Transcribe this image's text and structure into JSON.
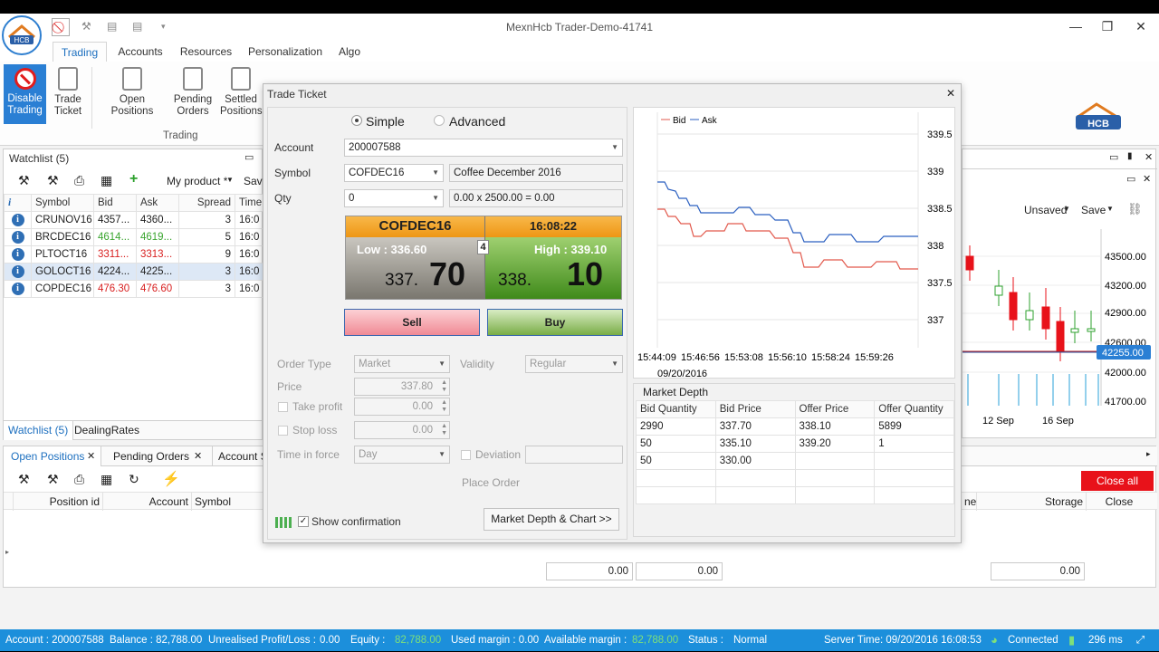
{
  "window": {
    "title": "MexnHcb Trader-Demo-41741"
  },
  "ribbon_tabs": [
    "Trading",
    "Accounts",
    "Resources",
    "Personalization",
    "Algo"
  ],
  "ribbon": {
    "disable_trading": "Disable\nTrading",
    "trade_ticket": "Trade\nTicket",
    "open_positions": "Open Positions",
    "pending_orders": "Pending\nOrders",
    "settled_positions": "Settled\nPositions",
    "group_label": "Trading"
  },
  "logo_text": "HCB",
  "watchlist": {
    "title": "Watchlist (5)",
    "my_product": "My product *",
    "save_short": "Sav",
    "columns": [
      "Symbol",
      "Bid",
      "Ask",
      "Spread",
      "Time"
    ],
    "rows": [
      {
        "symbol": "CRUNOV16",
        "bid": "4357...",
        "ask": "4360...",
        "spread": "3",
        "time": "16:0",
        "bid_color": "",
        "ask_color": ""
      },
      {
        "symbol": "BRCDEC16",
        "bid": "4614...",
        "ask": "4619...",
        "spread": "5",
        "time": "16:0",
        "bid_color": "green",
        "ask_color": "green"
      },
      {
        "symbol": "PLTOCT16",
        "bid": "3311...",
        "ask": "3313...",
        "spread": "9",
        "time": "16:0",
        "bid_color": "red",
        "ask_color": "red"
      },
      {
        "symbol": "GOLOCT16",
        "bid": "4224...",
        "ask": "4225...",
        "spread": "3",
        "time": "16:0",
        "bid_color": "",
        "ask_color": ""
      },
      {
        "symbol": "COPDEC16",
        "bid": "476.30",
        "ask": "476.60",
        "spread": "3",
        "time": "16:0",
        "bid_color": "red",
        "ask_color": "red"
      }
    ],
    "tabs": [
      "Watchlist (5)",
      "DealingRates"
    ]
  },
  "bottom_panel": {
    "tabs": [
      "Open Positions",
      "Pending Orders",
      "Account S"
    ],
    "columns": [
      "Position id",
      "Account",
      "Symbol"
    ],
    "right_columns": [
      "ne",
      "Storage",
      "Close"
    ],
    "close_all": "Close all",
    "totals": [
      "0.00",
      "0.00",
      "0.00"
    ]
  },
  "right_chart": {
    "unsaved": "Unsaved",
    "save": "Save",
    "y_ticks": [
      "43500.00",
      "43200.00",
      "42900.00",
      "42600.00",
      "42000.00",
      "41700.00"
    ],
    "current_price": "42255.00",
    "x_ticks": [
      "12 Sep",
      "16 Sep"
    ]
  },
  "ticket": {
    "title": "Trade Ticket",
    "mode_simple": "Simple",
    "mode_advanced": "Advanced",
    "account_label": "Account",
    "account_value": "200007588",
    "symbol_label": "Symbol",
    "symbol_value": "COFDEC16",
    "symbol_desc": "Coffee December 2016",
    "qty_label": "Qty",
    "qty_value": "0",
    "qty_calc": "0.00 x 2500.00 = 0.00",
    "quote": {
      "symbol": "COFDEC16",
      "time": "16:08:22",
      "low": "Low : 336.60",
      "high": "High : 339.10",
      "spread": "4",
      "bid_small": "337.",
      "bid_big": "70",
      "ask_small": "338.",
      "ask_big": "10"
    },
    "sell": "Sell",
    "buy": "Buy",
    "order_type_label": "Order Type",
    "order_type": "Market",
    "validity_label": "Validity",
    "validity": "Regular",
    "price_label": "Price",
    "price": "337.80",
    "take_profit_label": "Take profit",
    "take_profit": "0.00",
    "stop_loss_label": "Stop loss",
    "stop_loss": "0.00",
    "tif_label": "Time in force",
    "tif": "Day",
    "deviation_label": "Deviation",
    "place_order": "Place Order",
    "show_confirmation": "Show confirmation",
    "market_depth_btn": "Market Depth & Chart >>"
  },
  "mini_chart": {
    "legend": [
      "Bid",
      "Ask"
    ],
    "y_ticks": [
      "339.5",
      "339",
      "338.5",
      "338",
      "337.5",
      "337"
    ],
    "x_ticks": [
      "15:44:09",
      "15:46:56",
      "15:53:08",
      "15:56:10",
      "15:58:24",
      "15:59:26"
    ],
    "date": "09/20/2016"
  },
  "market_depth": {
    "title": "Market Depth",
    "columns": [
      "Bid Quantity",
      "Bid Price",
      "Offer Price",
      "Offer Quantity"
    ],
    "rows": [
      [
        "2990",
        "337.70",
        "338.10",
        "5899"
      ],
      [
        "50",
        "335.10",
        "339.20",
        "1"
      ],
      [
        "50",
        "330.00",
        "",
        ""
      ],
      [
        "",
        "",
        "",
        ""
      ],
      [
        "",
        "",
        "",
        ""
      ]
    ]
  },
  "status": {
    "account": "Account : 200007588",
    "balance": "Balance : 82,788.00",
    "upl_label": "Unrealised Profit/Loss :",
    "upl": "0.00",
    "equity_label": "Equity :",
    "equity": "82,788.00",
    "used_margin": "Used margin : 0.00",
    "avail_label": "Available margin :",
    "avail": "82,788.00",
    "status_label": "Status :",
    "status": "Normal",
    "server_time": "Server Time: 09/20/2016 16:08:53",
    "connected": "Connected",
    "latency": "296 ms"
  },
  "colors": {
    "accent": "#1c8fdb",
    "sell": "#f7a8b0",
    "buy": "#8dbf57",
    "quote_head": "#f5a623",
    "close_all": "#e8121a"
  }
}
